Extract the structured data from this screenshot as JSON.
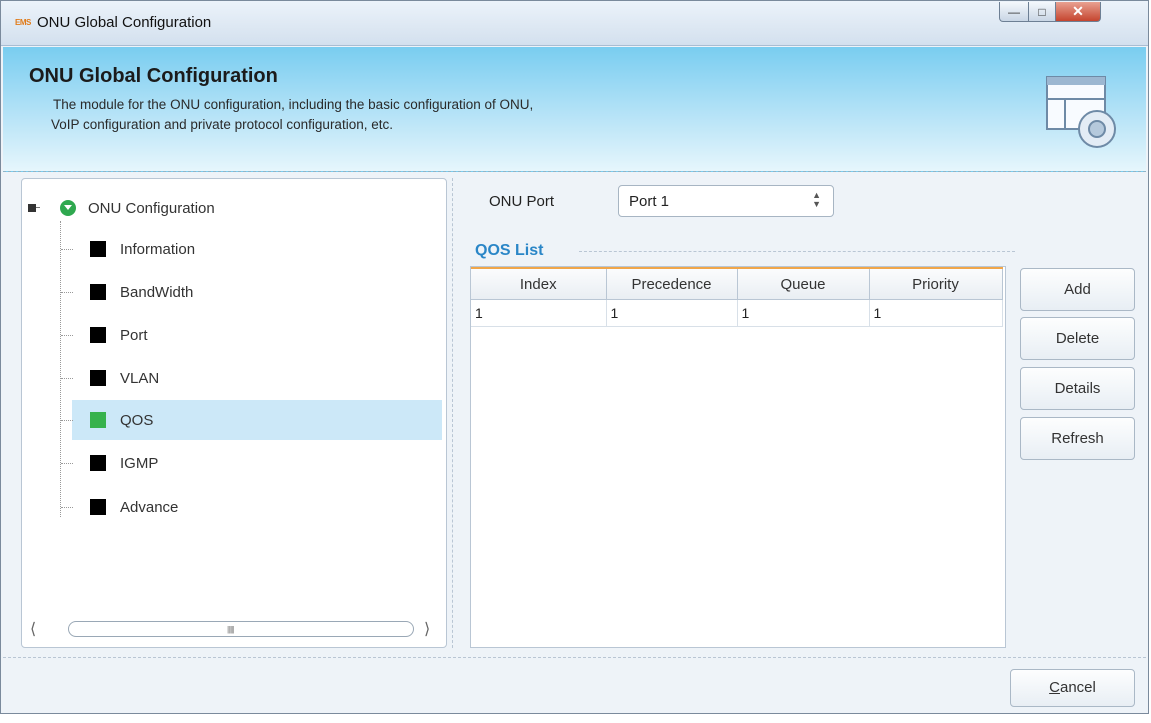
{
  "window": {
    "app_icon": "EMS",
    "title": "ONU Global Configuration",
    "controls": {
      "minimize": "minimize-icon",
      "maximize": "maximize-icon",
      "close": "close-icon"
    }
  },
  "header": {
    "title": "ONU Global Configuration",
    "desc_line1": "The module for the ONU configuration, including the basic configuration of ONU,",
    "desc_line2": "VoIP configuration and private protocol configuration, etc.",
    "icon": "config-window-gear-icon"
  },
  "tree": {
    "root_label": "ONU Configuration",
    "items": [
      {
        "label": "Information"
      },
      {
        "label": "BandWidth"
      },
      {
        "label": "Port"
      },
      {
        "label": "VLAN"
      },
      {
        "label": "QOS",
        "selected": true
      },
      {
        "label": "IGMP"
      },
      {
        "label": "Advance"
      }
    ]
  },
  "port": {
    "label": "ONU Port",
    "value": "Port 1"
  },
  "qos": {
    "title": "QOS List",
    "columns": [
      "Index",
      "Precedence",
      "Queue",
      "Priority"
    ],
    "rows": [
      [
        "1",
        "1",
        "1",
        "1"
      ]
    ]
  },
  "buttons": {
    "add": "Add",
    "delete": "Delete",
    "details": "Details",
    "refresh": "Refresh",
    "cancel_rest": "ancel",
    "cancel_key": "C"
  },
  "colors": {
    "header_top": "#79cdf0",
    "selected_row": "#cce8f8",
    "accent_text": "#2a86c7",
    "table_header_line": "#f0a64a",
    "qos_square": "#37b24d"
  }
}
